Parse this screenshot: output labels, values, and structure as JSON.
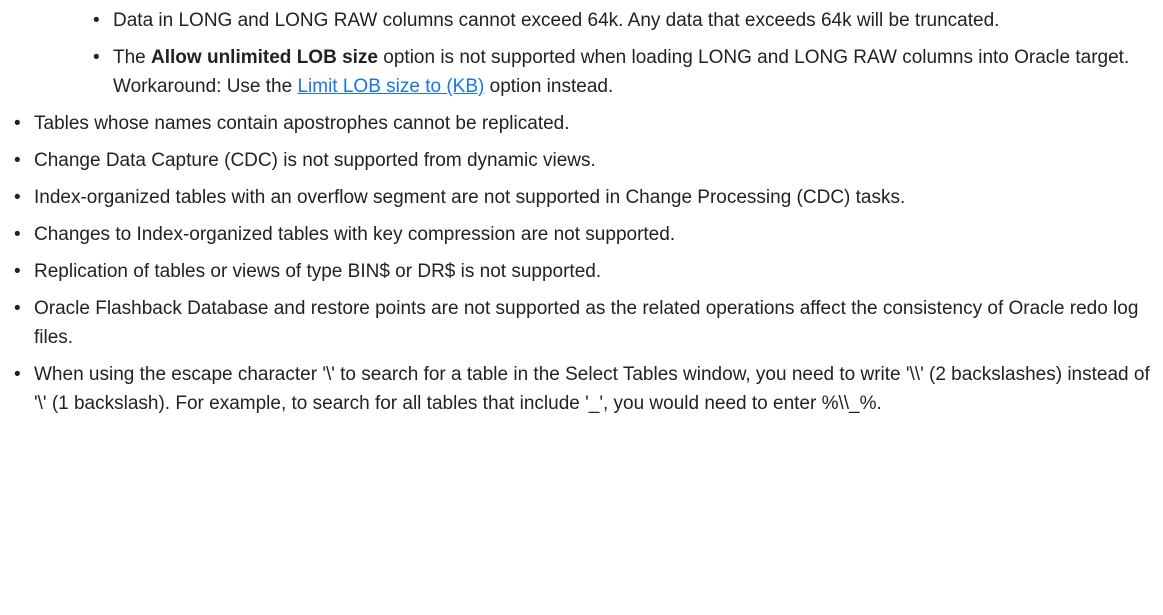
{
  "sub_items": [
    {
      "text": "Data in LONG and LONG RAW columns cannot exceed 64k. Any data that exceeds 64k will be truncated."
    },
    {
      "prefix": "The ",
      "bold": "Allow unlimited LOB size",
      "suffix": " option is not supported when loading LONG and LONG RAW columns into Oracle target.",
      "workaround_prefix": "Workaround: Use the ",
      "link": "Limit LOB size to (KB)",
      "workaround_suffix": " option instead."
    }
  ],
  "items": [
    "Tables whose names contain apostrophes cannot be replicated.",
    "Change Data Capture (CDC) is not supported from dynamic views.",
    "Index-organized tables with an overflow segment are not supported in Change Processing (CDC) tasks.",
    "Changes to Index-organized tables with key compression are not supported.",
    "Replication of tables or views of type BIN$ or DR$ is not supported.",
    "Oracle Flashback Database and restore points are not supported as the related operations affect the consistency of Oracle redo log files.",
    "When using the escape character '\\' to search for a table in the Select Tables window, you need to write '\\\\' (2 backslashes) instead of '\\' (1 backslash). For example, to search for all tables that include '_', you would need to enter %\\\\_%."
  ]
}
